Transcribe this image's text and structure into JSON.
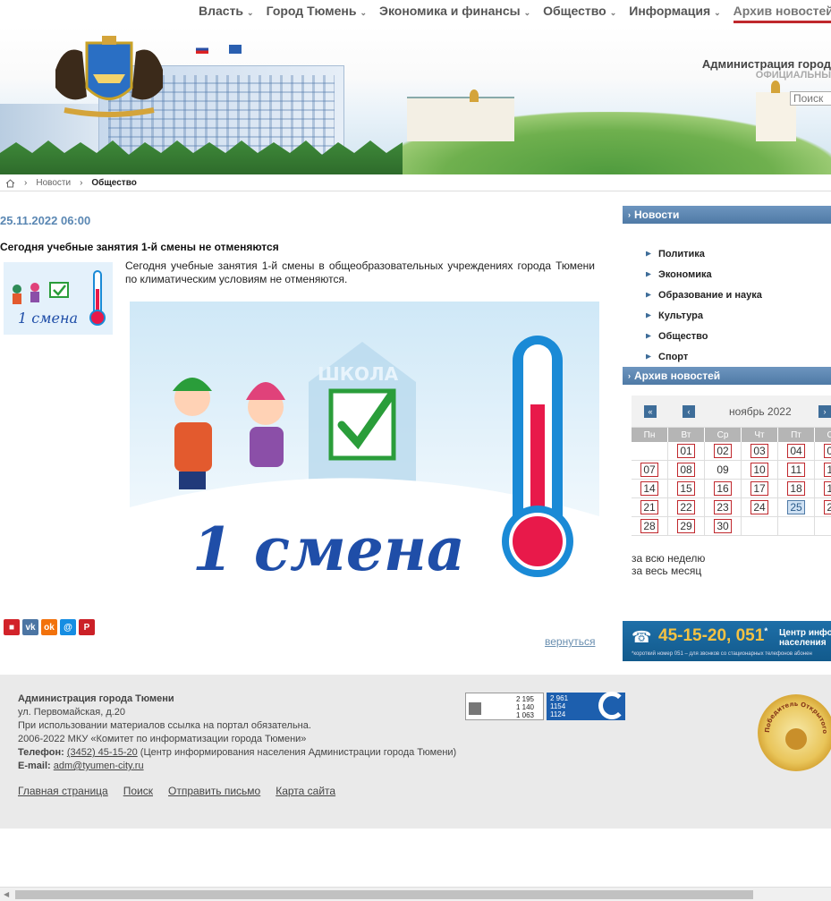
{
  "nav": {
    "items": [
      {
        "label": "Власть"
      },
      {
        "label": "Город Тюмень"
      },
      {
        "label": "Экономика и финансы"
      },
      {
        "label": "Общество"
      },
      {
        "label": "Информация"
      },
      {
        "label": "Архив новостей"
      }
    ]
  },
  "header": {
    "admin_title": "Администрация город",
    "admin_sub": "ОФИЦИАЛЬНЫ",
    "search_placeholder": "Поиск"
  },
  "breadcrumb": {
    "items": [
      "Новости",
      "Общество"
    ]
  },
  "article": {
    "date": "25.11.2022 06:00",
    "title": "Сегодня учебные занятия 1-й смены не отменяются",
    "lead": "Сегодня учебные занятия 1-й смены в общеобразовательных учреждениях города Тюмени по климатическим условиям не отменяются.",
    "image_school_label": "ШКОЛА",
    "image_caption": "1 смена",
    "thumb_caption": "1 смена",
    "back_label": "вернуться"
  },
  "sidebar": {
    "news_title": "Новости",
    "categories": [
      "Политика",
      "Экономика",
      "Образование и наука",
      "Культура",
      "Общество",
      "Спорт"
    ],
    "archive_title": "Архив новостей"
  },
  "calendar": {
    "month": "ноябрь 2022",
    "weekdays": [
      "Пн",
      "Вт",
      "Ср",
      "Чт",
      "Пт",
      "Сб"
    ],
    "rows": [
      [
        "",
        "01",
        "02",
        "03",
        "04",
        "05"
      ],
      [
        "07",
        "08",
        "09",
        "10",
        "11",
        "12"
      ],
      [
        "14",
        "15",
        "16",
        "17",
        "18",
        "19"
      ],
      [
        "21",
        "22",
        "23",
        "24",
        "25",
        "26"
      ],
      [
        "28",
        "29",
        "30",
        "",
        "",
        ""
      ]
    ],
    "plain_days": [
      "09"
    ],
    "today": "25",
    "link_week": "за всю неделю",
    "link_month": "за весь месяц"
  },
  "phone_banner": {
    "number": "45-15-20, 051",
    "asterisk": "*",
    "text_line1": "Центр инфо",
    "text_line2": "населения",
    "footnote": "*короткий номер 051 – для звонков со стационарных телефонов абонен"
  },
  "footer": {
    "org": "Администрация города Тюмени",
    "address": "ул. Первомайская, д.20",
    "copy_note": "При использовании материалов ссылка на портал обязательна.",
    "years": "2006-2022 МКУ «Комитет по информатизации города Тюмени»",
    "phone_label": "Телефон:",
    "phone_value": "(3452) 45-15-20",
    "phone_note": " (Центр информирования населения Администрации города Тюмени)",
    "email_label": "E-mail:",
    "email_value": "adm@tyumen-city.ru",
    "links": [
      "Главная страница",
      "Поиск",
      "Отправить письмо",
      "Карта сайта"
    ],
    "counter1": [
      "2 195",
      "1 140",
      "1 063"
    ],
    "counter2": [
      "2 961",
      "1154",
      "1124"
    ],
    "seal_text": "Победитель Открытого конк"
  },
  "colors": {
    "accent": "#c0282d",
    "sidebar_header": "#4f7aa6",
    "date": "#5a87b3"
  }
}
